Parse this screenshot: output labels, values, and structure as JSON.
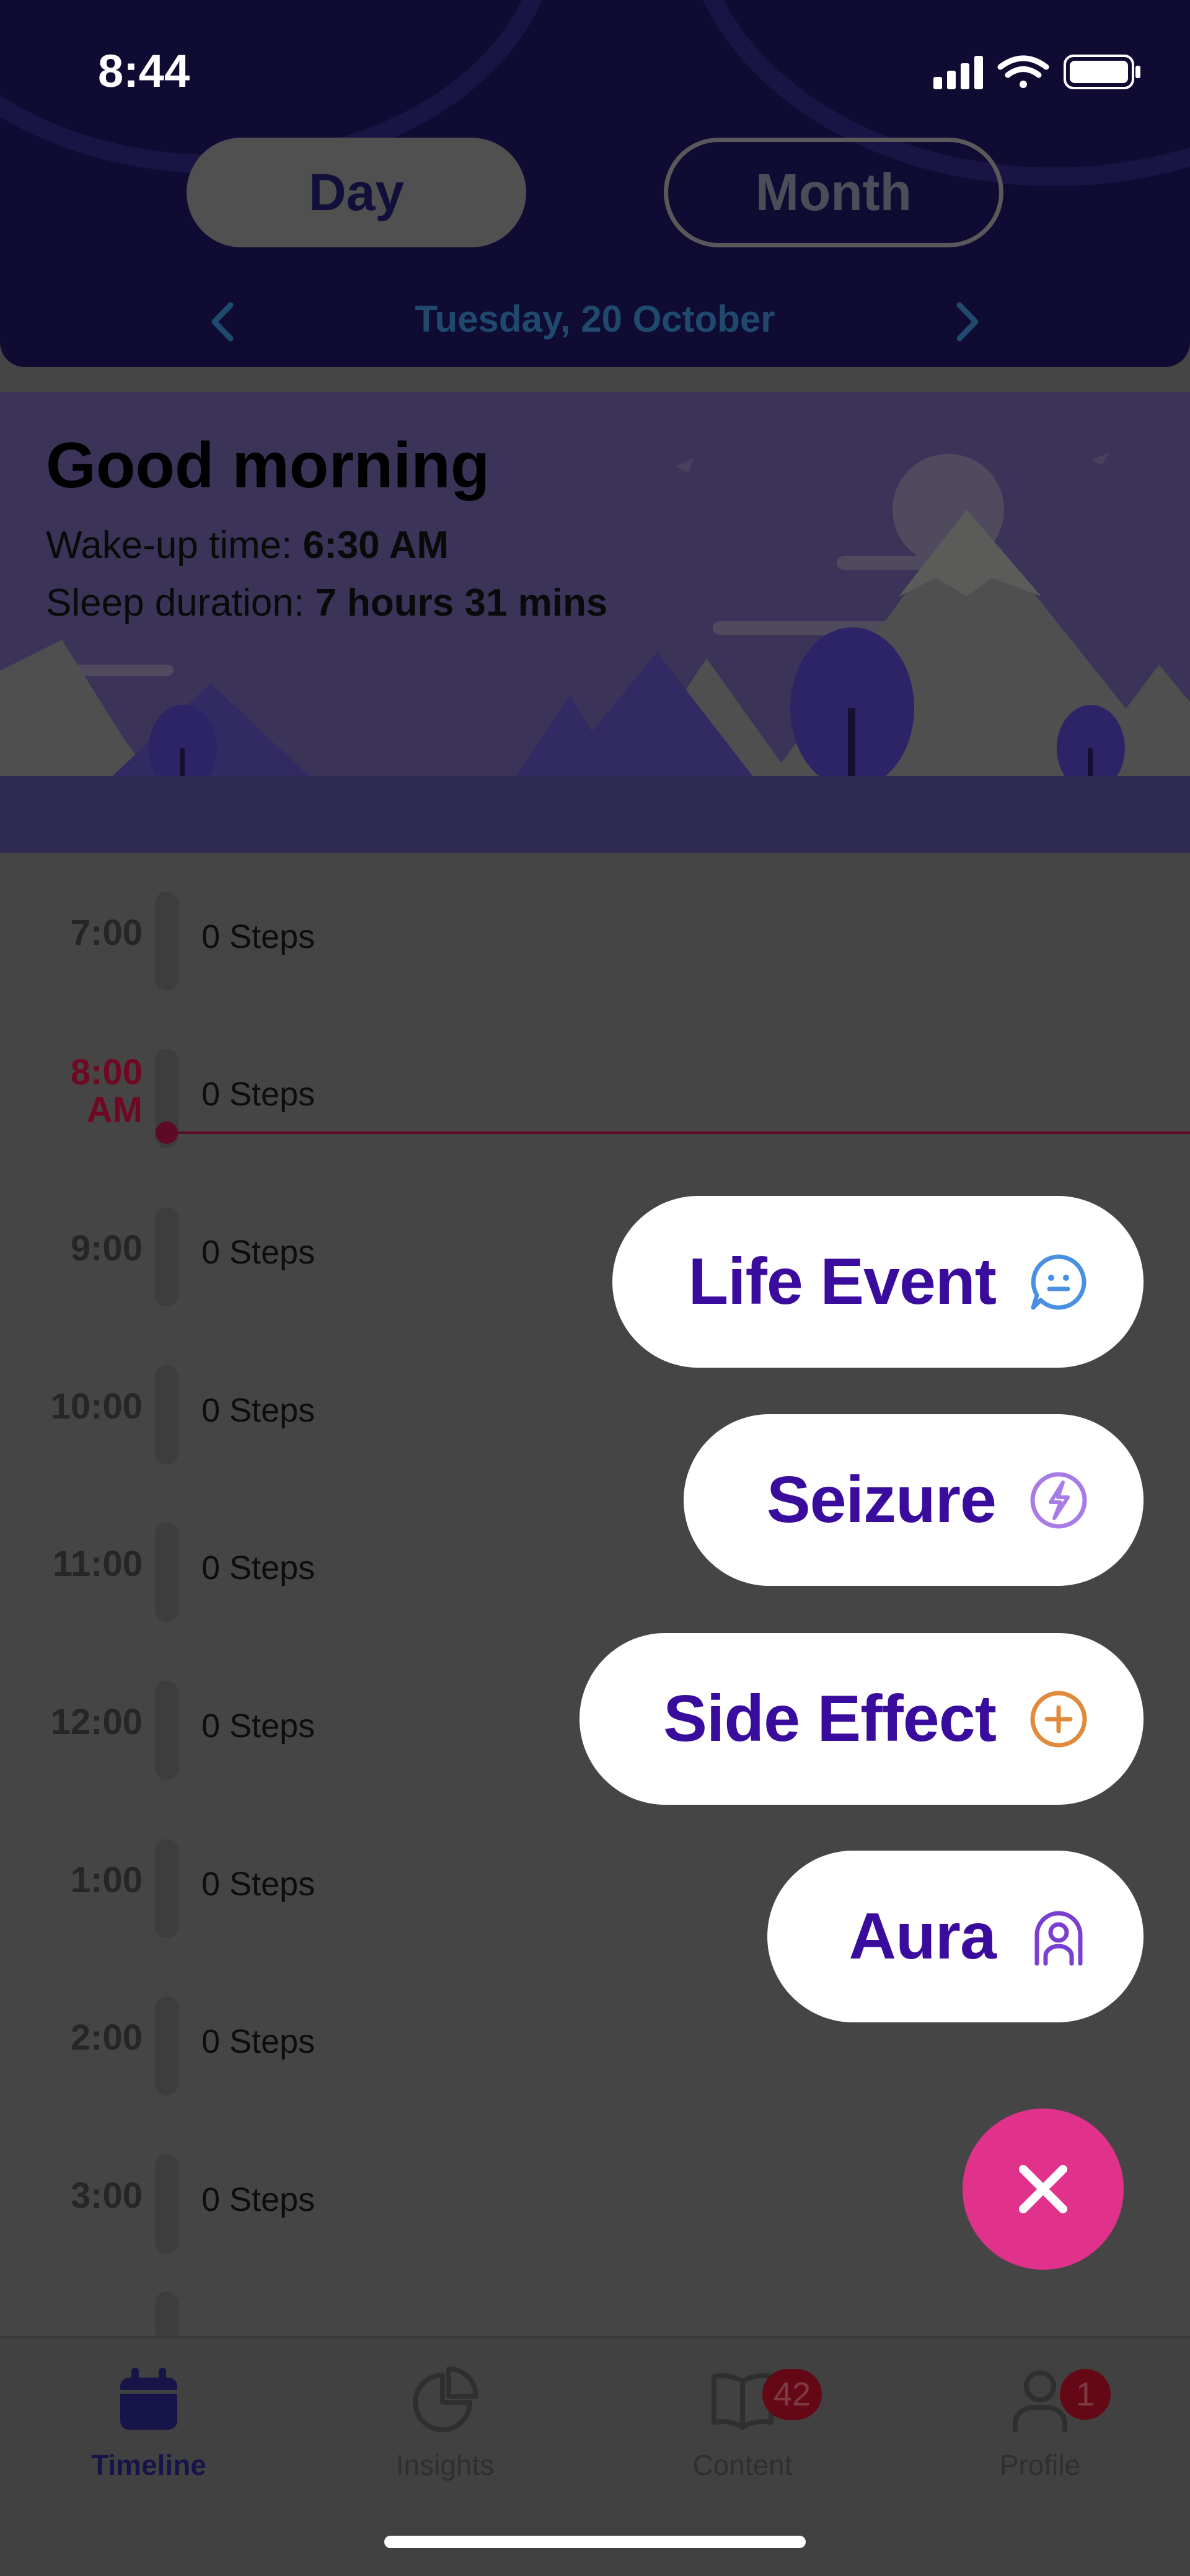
{
  "status_bar": {
    "time": "8:44"
  },
  "header": {
    "segments": {
      "day": "Day",
      "month": "Month",
      "selected": "Day"
    },
    "date": "Tuesday, 20 October"
  },
  "greeting": {
    "title": "Good morning",
    "wake_label": "Wake-up time: ",
    "wake_value": "6:30 AM",
    "sleep_label": "Sleep duration: ",
    "sleep_value": "7 hours 31 mins"
  },
  "timeline": {
    "current_hour_line1": "8:00",
    "current_hour_line2": "AM",
    "rows": [
      {
        "hour": "7:00",
        "steps": "0 Steps"
      },
      {
        "hour": "8:00 AM",
        "steps": "0 Steps"
      },
      {
        "hour": "9:00",
        "steps": "0 Steps"
      },
      {
        "hour": "10:00",
        "steps": "0 Steps"
      },
      {
        "hour": "11:00",
        "steps": "0 Steps"
      },
      {
        "hour": "12:00",
        "steps": "0 Steps"
      },
      {
        "hour": "1:00",
        "steps": "0 Steps"
      },
      {
        "hour": "2:00",
        "steps": "0 Steps"
      },
      {
        "hour": "3:00",
        "steps": "0 Steps"
      }
    ]
  },
  "action_menu": {
    "items": [
      {
        "label": "Life Event",
        "icon": "chat-bubble-icon",
        "color": "#4a90e2"
      },
      {
        "label": "Seizure",
        "icon": "lightning-icon",
        "color": "#a77ce8"
      },
      {
        "label": "Side Effect",
        "icon": "plus-circle-icon",
        "color": "#e08a3c"
      },
      {
        "label": "Aura",
        "icon": "person-aura-icon",
        "color": "#7a3fd1"
      }
    ],
    "close_icon": "close-icon"
  },
  "tabbar": {
    "tabs": [
      {
        "label": "Timeline",
        "icon": "calendar-icon",
        "active": true
      },
      {
        "label": "Insights",
        "icon": "pie-chart-icon"
      },
      {
        "label": "Content",
        "icon": "book-icon",
        "badge": "42"
      },
      {
        "label": "Profile",
        "icon": "person-icon",
        "badge": "1"
      }
    ]
  },
  "colors": {
    "brand_purple": "#3a0c9e",
    "fab_pink": "#e0328b",
    "header_navy": "#0f0b33",
    "now_line": "#5c0a26"
  }
}
